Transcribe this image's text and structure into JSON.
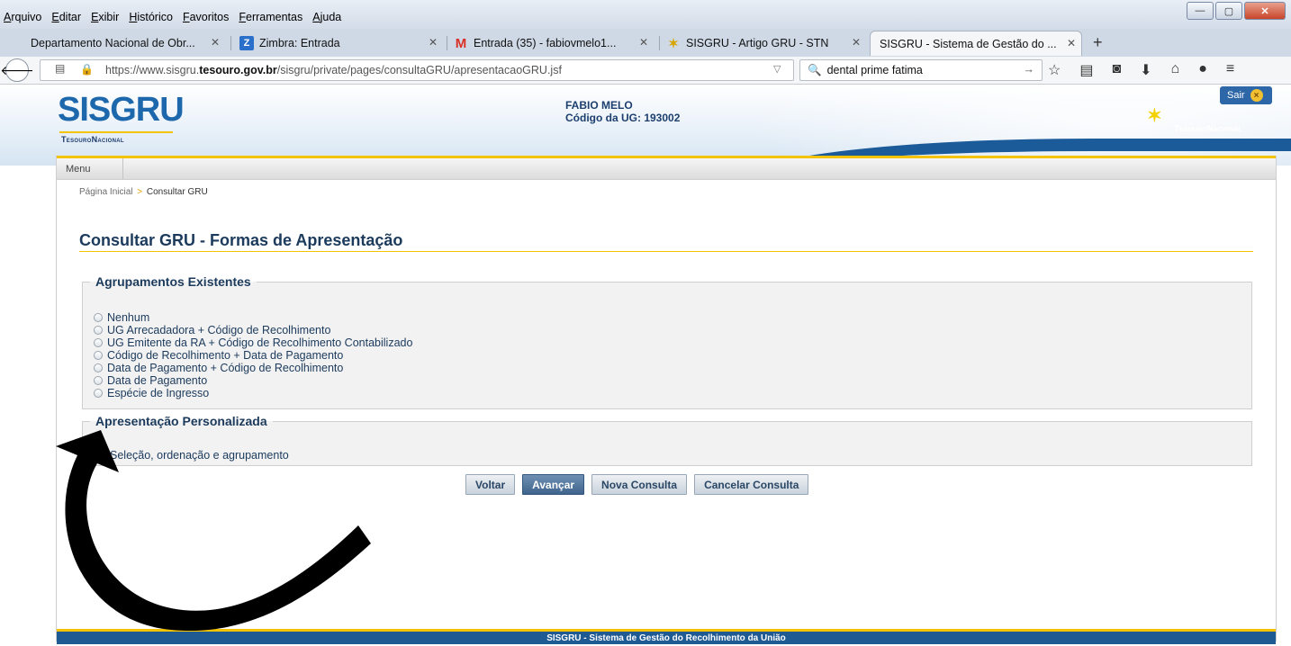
{
  "browser": {
    "menu": [
      "Arquivo",
      "Editar",
      "Exibir",
      "Histórico",
      "Favoritos",
      "Ferramentas",
      "Ajuda"
    ],
    "tabs": [
      {
        "label": "Departamento Nacional de Obr...",
        "icon": "none"
      },
      {
        "label": "Zimbra: Entrada",
        "icon": "zimbra-icon"
      },
      {
        "label": "Entrada (35) - fabiovmelo1...",
        "icon": "gmail-icon"
      },
      {
        "label": "SISGRU - Artigo GRU - STN",
        "icon": "tesouro-icon"
      },
      {
        "label": "SISGRU - Sistema de Gestão do ...",
        "icon": "none",
        "active": true
      }
    ],
    "url_prefix": "https://www.sisgru.",
    "url_domain": "tesouro.gov.br",
    "url_suffix": "/sisgru/private/pages/consultaGRU/apresentacaoGRU.jsf",
    "search_value": "dental prime fatima"
  },
  "header": {
    "logo": "SISGRU",
    "logo_sub": "TesouroNacional",
    "user_name": "FABIO MELO",
    "user_ug": "Código da UG: 193002",
    "sair_label": "Sair",
    "tn_logo": "TesouroNacional"
  },
  "nav": {
    "menu_label": "Menu",
    "breadcrumb_home": "Página Inicial",
    "breadcrumb_sep": ">",
    "breadcrumb_current": "Consultar GRU"
  },
  "page": {
    "title": "Consultar GRU - Formas de Apresentação",
    "agrupamentos": {
      "legend": "Agrupamentos Existentes",
      "options": [
        "Nenhum",
        "UG Arrecadadora + Código de Recolhimento",
        "UG Emitente da RA + Código de Recolhimento Contabilizado",
        "Código de Recolhimento + Data de Pagamento",
        "Data de Pagamento + Código de Recolhimento",
        "Data de Pagamento",
        "Espécie de Ingresso"
      ]
    },
    "personalizada": {
      "legend": "Apresentação Personalizada",
      "link": "Seleção, ordenação e agrupamento"
    },
    "buttons": {
      "voltar": "Voltar",
      "avancar": "Avançar",
      "nova": "Nova Consulta",
      "cancelar": "Cancelar Consulta"
    }
  },
  "footer": {
    "text": "SISGRU - Sistema de Gestão do Recolhimento da União"
  },
  "colors": {
    "accent_yellow": "#f4c300",
    "brand_blue": "#1d67ad",
    "title_navy": "#1b3a5c"
  }
}
